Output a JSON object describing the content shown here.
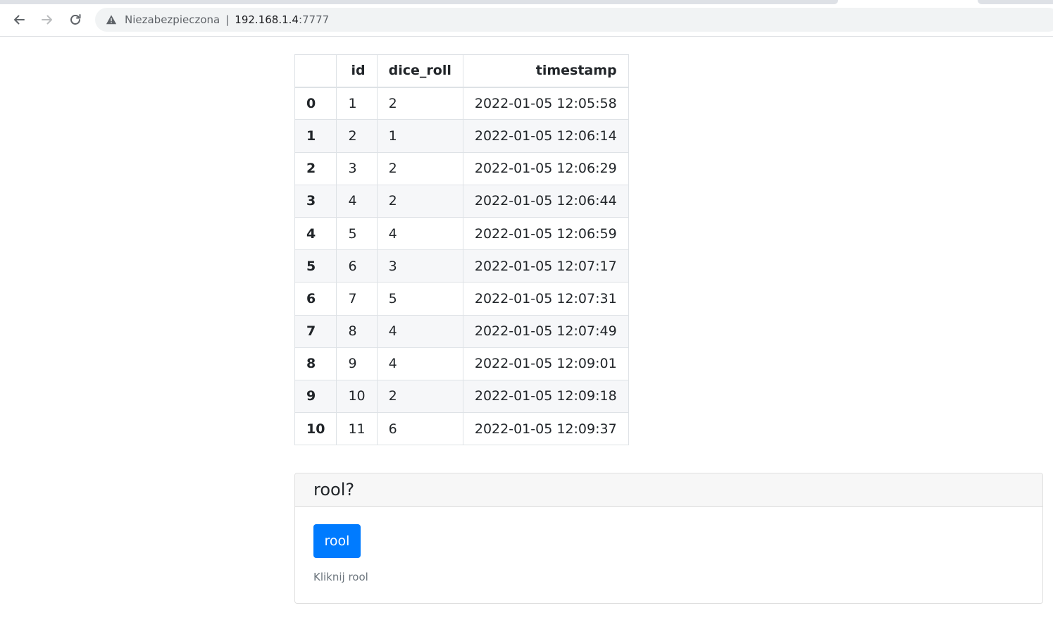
{
  "browser": {
    "security_label": "Niezabezpieczona",
    "separator": "|",
    "url_host": "192.168.1.4",
    "url_port": ":7777",
    "icons": {
      "back": "arrow-left-icon",
      "forward": "arrow-right-icon",
      "reload": "reload-icon",
      "security": "warning-triangle-icon"
    }
  },
  "table": {
    "headers": [
      "",
      "id",
      "dice_roll",
      "timestamp"
    ],
    "rows": [
      {
        "index": "0",
        "id": "1",
        "dice_roll": "2",
        "timestamp": "2022-01-05 12:05:58"
      },
      {
        "index": "1",
        "id": "2",
        "dice_roll": "1",
        "timestamp": "2022-01-05 12:06:14"
      },
      {
        "index": "2",
        "id": "3",
        "dice_roll": "2",
        "timestamp": "2022-01-05 12:06:29"
      },
      {
        "index": "3",
        "id": "4",
        "dice_roll": "2",
        "timestamp": "2022-01-05 12:06:44"
      },
      {
        "index": "4",
        "id": "5",
        "dice_roll": "4",
        "timestamp": "2022-01-05 12:06:59"
      },
      {
        "index": "5",
        "id": "6",
        "dice_roll": "3",
        "timestamp": "2022-01-05 12:07:17"
      },
      {
        "index": "6",
        "id": "7",
        "dice_roll": "5",
        "timestamp": "2022-01-05 12:07:31"
      },
      {
        "index": "7",
        "id": "8",
        "dice_roll": "4",
        "timestamp": "2022-01-05 12:07:49"
      },
      {
        "index": "8",
        "id": "9",
        "dice_roll": "4",
        "timestamp": "2022-01-05 12:09:01"
      },
      {
        "index": "9",
        "id": "10",
        "dice_roll": "2",
        "timestamp": "2022-01-05 12:09:18"
      },
      {
        "index": "10",
        "id": "11",
        "dice_roll": "6",
        "timestamp": "2022-01-05 12:09:37"
      }
    ]
  },
  "card": {
    "title": "rool?",
    "button_label": "rool",
    "helper_text": "Kliknij rool",
    "button_color": "#007bff"
  }
}
